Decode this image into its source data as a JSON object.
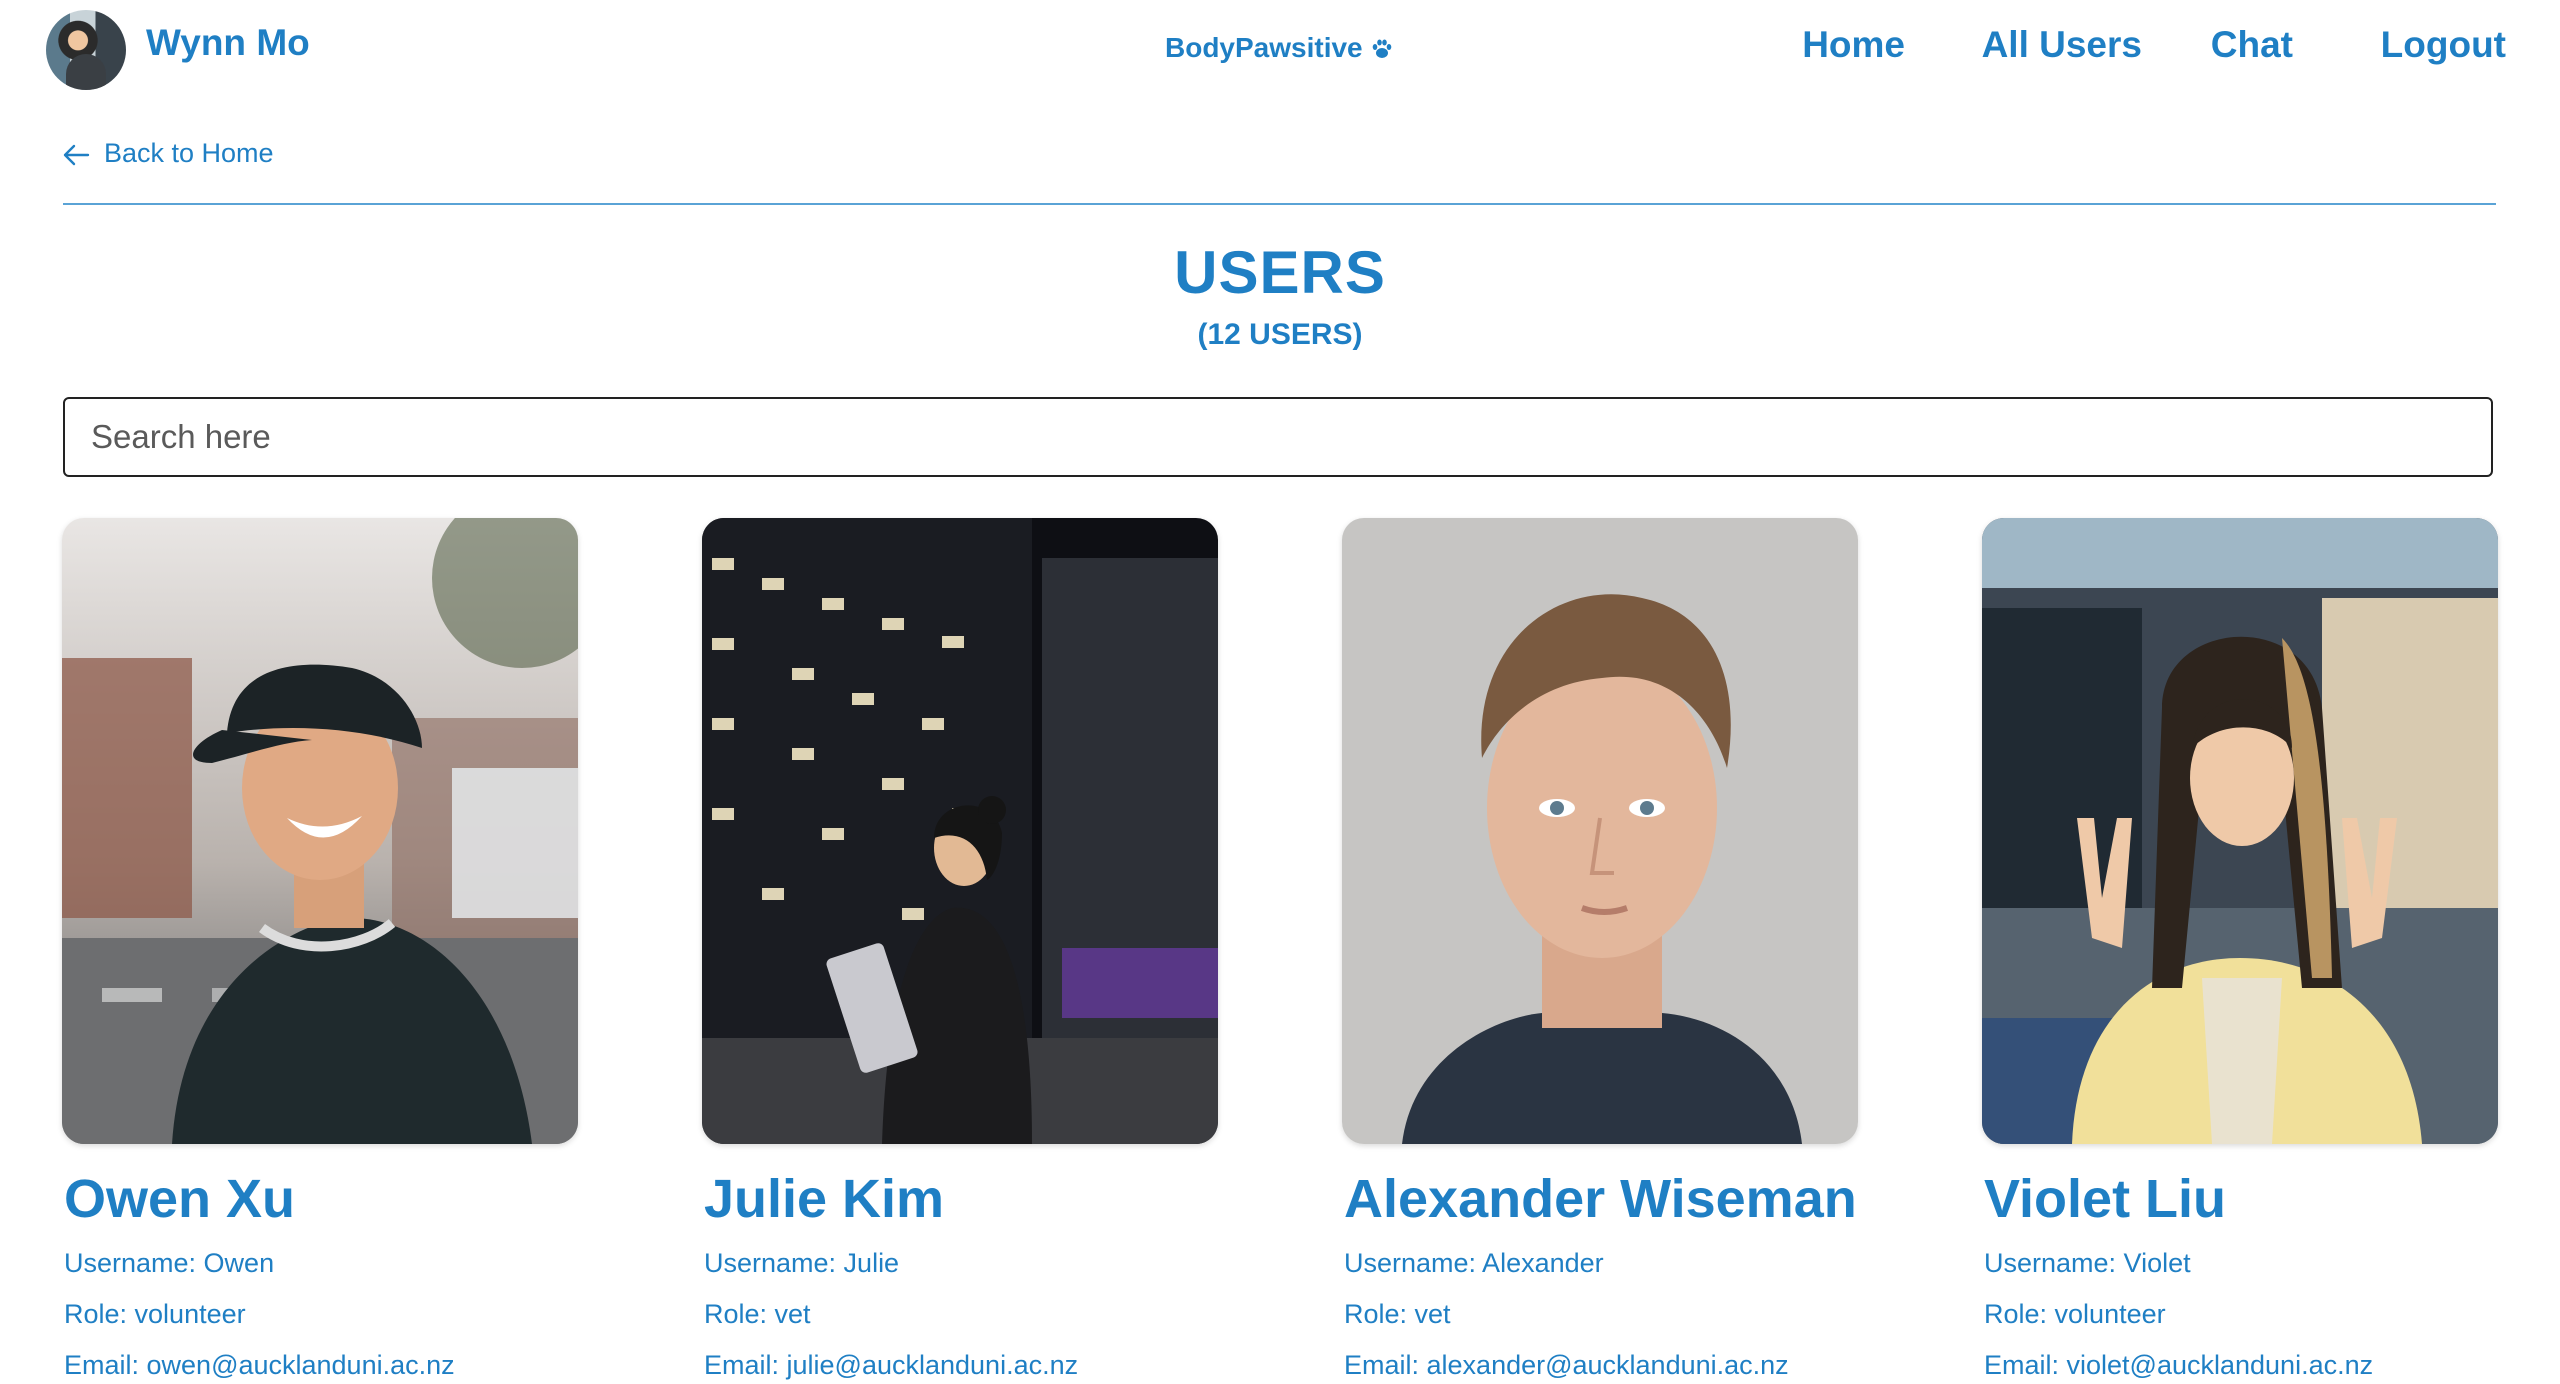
{
  "header": {
    "user_name": "Wynn Mo",
    "brand": "BodyPawsitive",
    "nav": [
      "Home",
      "All Users",
      "Chat",
      "Logout"
    ]
  },
  "back_link": "Back to Home",
  "page": {
    "title": "USERS",
    "subtitle": "(12 USERS)"
  },
  "search": {
    "placeholder": "Search here",
    "value": ""
  },
  "users": [
    {
      "name": "Owen Xu",
      "username": "Username: Owen",
      "role": "Role: volunteer",
      "email": "Email: owen@aucklanduni.ac.nz"
    },
    {
      "name": "Julie Kim",
      "username": "Username: Julie",
      "role": "Role: vet",
      "email": "Email: julie@aucklanduni.ac.nz"
    },
    {
      "name": "Alexander Wiseman",
      "username": "Username: Alexander",
      "role": "Role: vet",
      "email": "Email: alexander@aucklanduni.ac.nz"
    },
    {
      "name": "Violet Liu",
      "username": "Username: Violet",
      "role": "Role: volunteer",
      "email": "Email: violet@aucklanduni.ac.nz"
    }
  ],
  "colors": {
    "accent": "#1f7fc4",
    "rule": "#5aa3d6",
    "background": "#ffffff"
  },
  "icons": {
    "brand": "paw-icon",
    "back": "arrow-left-icon"
  }
}
